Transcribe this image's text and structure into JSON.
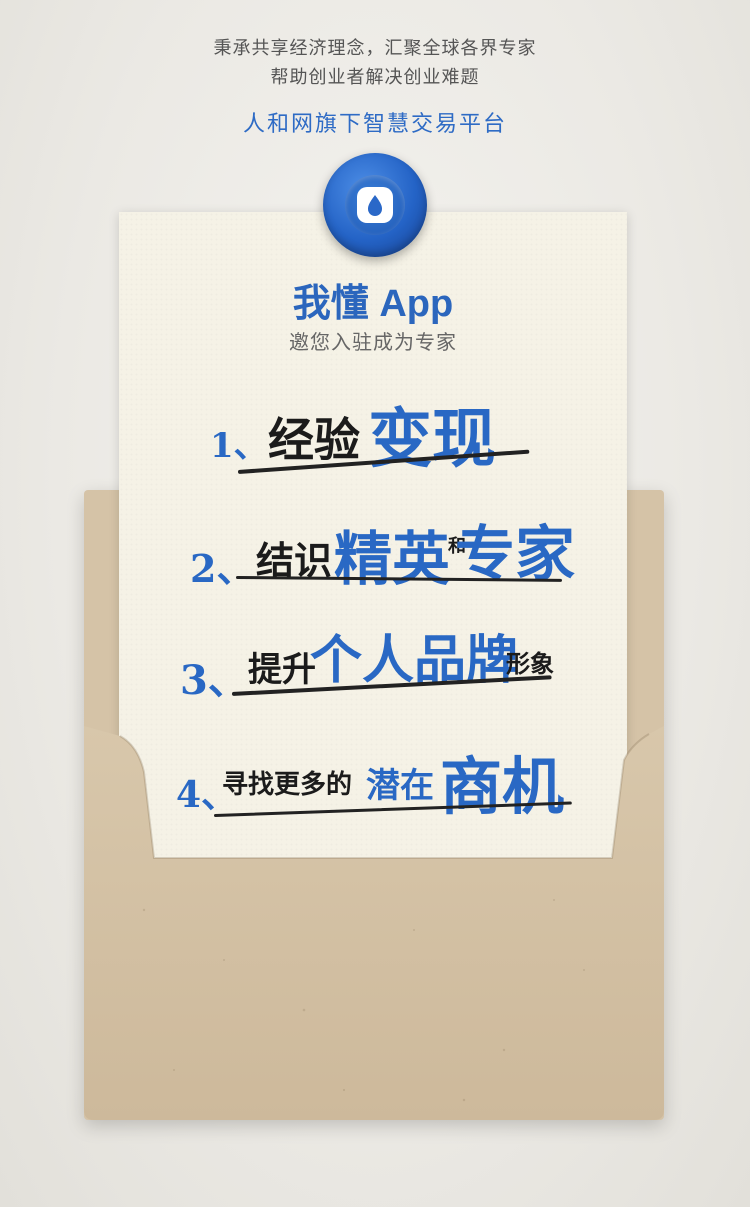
{
  "header": {
    "slogan_line1": "秉承共享经济理念，汇聚全球各界专家",
    "slogan_line2": "帮助创业者解决创业难题",
    "platform": "人和网旗下智慧交易平台"
  },
  "card": {
    "logo_icon": "water-drop-d-logo",
    "app_name": "我懂 App",
    "invite": "邀您入驻成为专家"
  },
  "benefits": [
    {
      "num": "1、",
      "parts": [
        "经验",
        "变现"
      ]
    },
    {
      "num": "2、",
      "parts": [
        "结识",
        "精英",
        "和",
        "专家"
      ]
    },
    {
      "num": "3、",
      "parts": [
        "提升",
        "个人品牌",
        "形象"
      ]
    },
    {
      "num": "4、",
      "parts": [
        "寻找更多的",
        "潜在",
        "商机"
      ]
    }
  ],
  "colors": {
    "brand_blue": "#2968c4",
    "envelope": "#d5c3a7",
    "paper": "#f5f2e6"
  }
}
